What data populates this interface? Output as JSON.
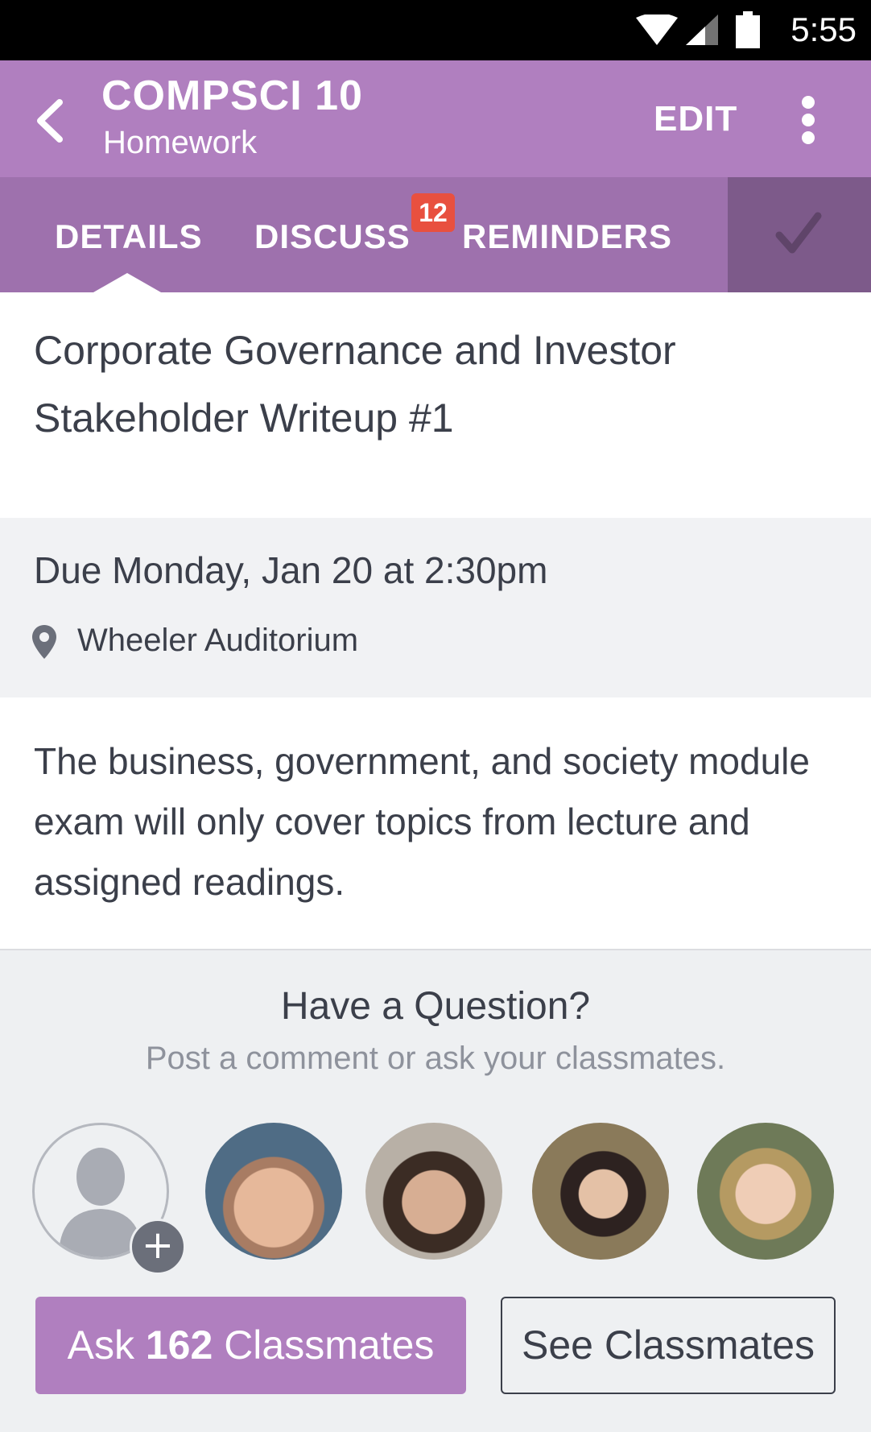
{
  "status_bar": {
    "time": "5:55"
  },
  "app_bar": {
    "title": "COMPSCI 10",
    "subtitle": "Homework",
    "edit_label": "EDIT"
  },
  "tabs": [
    {
      "label": "DETAILS",
      "active": true
    },
    {
      "label": "DISCUSS",
      "badge": "12"
    },
    {
      "label": "REMINDERS"
    }
  ],
  "assignment": {
    "title": "Corporate Governance and Investor Stakeholder Writeup #1",
    "due": "Due Monday, Jan 20 at 2:30pm",
    "location": "Wheeler Auditorium",
    "description": "The business, government, and society module exam will only cover topics from lecture and assigned readings."
  },
  "question": {
    "title": "Have a Question?",
    "subtitle": "Post a comment or ask your classmates.",
    "ask_prefix": "Ask",
    "ask_count": "162",
    "ask_suffix": "Classmates",
    "see_label": "See Classmates"
  },
  "icons": {
    "back": "chevron-left-icon",
    "more": "more-vertical-icon",
    "complete": "checkmark-icon",
    "location": "map-pin-icon",
    "add_avatar": "plus-icon"
  },
  "colors": {
    "app_bar": "#b07fbf",
    "tab_bar": "#9e71ad",
    "complete_bg": "#7d5a8a",
    "badge": "#e8503f",
    "text": "#3b3f4a",
    "muted": "#8e929c"
  }
}
